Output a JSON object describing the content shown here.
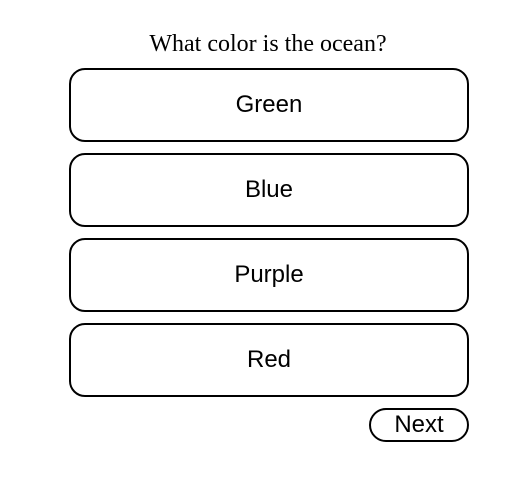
{
  "question": "What color is the ocean?",
  "answers": [
    {
      "label": "Green"
    },
    {
      "label": "Blue"
    },
    {
      "label": "Purple"
    },
    {
      "label": "Red"
    }
  ],
  "next_label": "Next",
  "colors": {
    "background": "#ffffff",
    "border": "#000000",
    "text": "#000000"
  }
}
